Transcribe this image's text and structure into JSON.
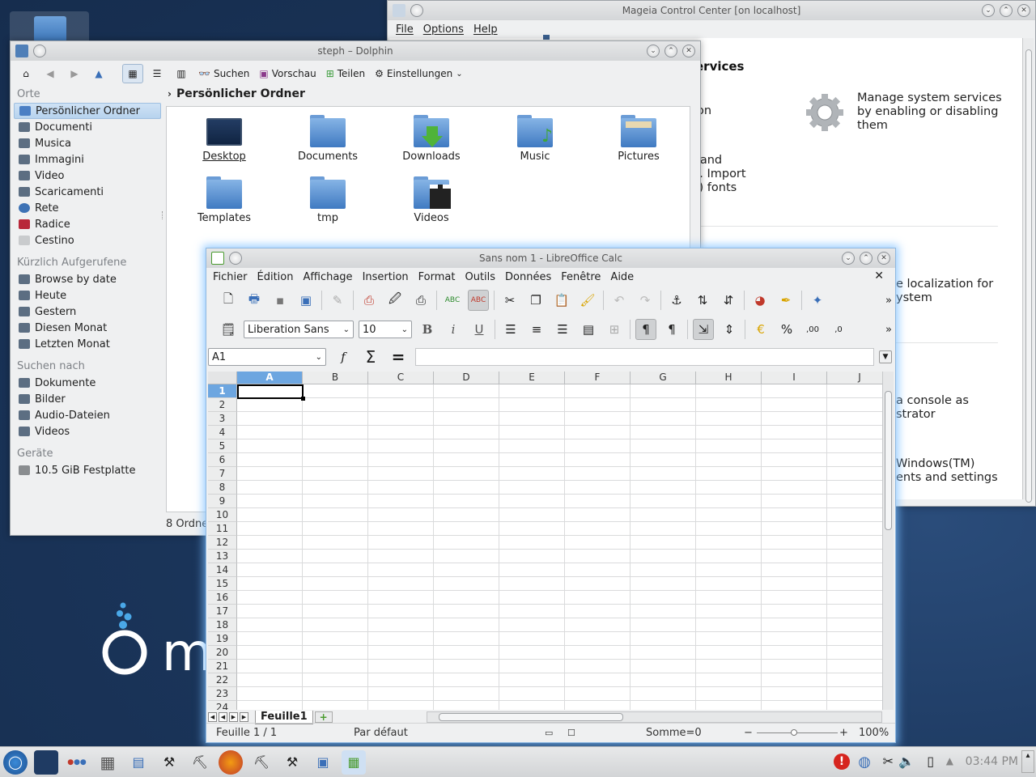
{
  "colors": {
    "desktop": "#1b365c",
    "selection": "#6da6e0",
    "calc_glow": "#78beff",
    "accent_blue": "#3b75b8"
  },
  "desktop": {
    "logo_text": "m"
  },
  "mcc": {
    "title": "Mageia Control Center  [on localhost]",
    "menus": [
      "File",
      "Options",
      "Help"
    ],
    "heading_partial": "ervices",
    "lines": {
      "on": "on",
      "services_desc": "Manage system services by enabling or disabling them",
      "fonts1": "d and",
      "fonts2": "ts. Import",
      "fonts3": "M) fonts",
      "localization1": "e localization for",
      "localization2": "ystem",
      "console1": "a console as",
      "console2": "strator",
      "windows1": "Windows(TM)",
      "windows2": "ents and settings"
    },
    "icons": {
      "services": "gear-icon"
    }
  },
  "dolphin": {
    "title": "steph – Dolphin",
    "toolbar": {
      "search": "Suchen",
      "preview": "Vorschau",
      "share": "Teilen",
      "settings": "Einstellungen"
    },
    "places": {
      "orte_label": "Orte",
      "orte": [
        "Persönlicher Ordner",
        "Documenti",
        "Musica",
        "Immagini",
        "Video",
        "Scaricamenti",
        "Rete",
        "Radice",
        "Cestino"
      ],
      "recent_label": "Kürzlich Aufgerufene",
      "recent": [
        "Browse by date",
        "Heute",
        "Gestern",
        "Diesen Monat",
        "Letzten Monat"
      ],
      "search_label": "Suchen nach",
      "search": [
        "Dokumente",
        "Bilder",
        "Audio-Dateien",
        "Videos"
      ],
      "devices_label": "Geräte",
      "devices": [
        "10.5 GiB Festplatte"
      ]
    },
    "breadcrumb": "Persönlicher Ordner",
    "files": [
      "Desktop",
      "Documents",
      "Downloads",
      "Music",
      "Pictures",
      "Templates",
      "tmp",
      "Videos"
    ],
    "status": "8 Ordne"
  },
  "calc": {
    "title": "Sans nom 1 - LibreOffice Calc",
    "menus": [
      "Fichier",
      "Édition",
      "Affichage",
      "Insertion",
      "Format",
      "Outils",
      "Données",
      "Fenêtre",
      "Aide"
    ],
    "font_name": "Liberation Sans",
    "font_size": "10",
    "name_box": "A1",
    "formula": "",
    "columns": [
      "A",
      "B",
      "C",
      "D",
      "E",
      "F",
      "G",
      "H",
      "I",
      "J"
    ],
    "rows": [
      "1",
      "2",
      "3",
      "4",
      "5",
      "6",
      "7",
      "8",
      "9",
      "10",
      "11",
      "12",
      "13",
      "14",
      "15",
      "16",
      "17",
      "18",
      "19",
      "20",
      "21",
      "22",
      "23",
      "24"
    ],
    "sheet_tab": "Feuille1",
    "status": {
      "sheet": "Feuille 1 / 1",
      "style": "Par défaut",
      "sum": "Somme=0",
      "zoom": "100%"
    },
    "toolbar_text": {
      "spell1": "ABC",
      "spell2": "ABC",
      "bold": "B",
      "italic": "i",
      "underline": "U",
      "percent": "%",
      "dec_add": ",00",
      "dec_del": ",0"
    }
  },
  "taskbar": {
    "clock": "03:44 PM"
  }
}
